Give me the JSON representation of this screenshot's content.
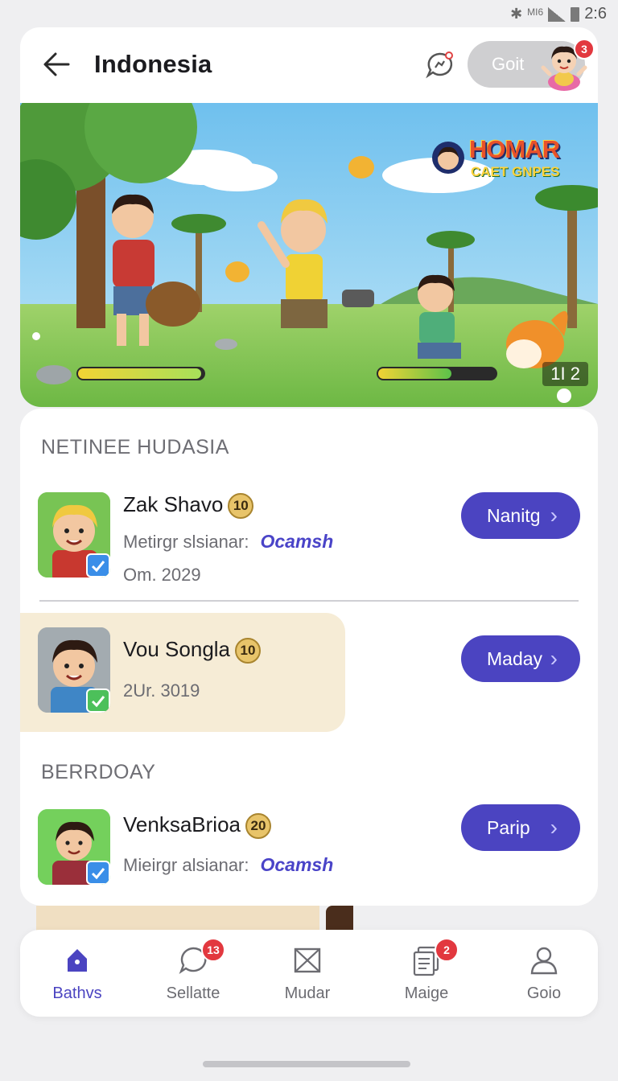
{
  "status_bar": {
    "network": "MI6",
    "time": "2:6"
  },
  "header": {
    "title": "Indonesia",
    "pill_label": "Goit",
    "pill_badge": "3"
  },
  "banner": {
    "logo_line1": "HOMAR",
    "logo_line2": "CAET GNPES",
    "score": "1I 2",
    "left_health": 0.98,
    "right_health": 0.62
  },
  "sections": [
    {
      "title": "NETINEE HUDASIA",
      "rows": [
        {
          "name": "Zak Shavo",
          "emoji_label": "10",
          "sub_label": "Metirgr slsianar:",
          "brand": "Ocamsh",
          "date": "Om. 2029",
          "button": "Nanitg"
        },
        {
          "name": "Vou Songla",
          "emoji_label": "10",
          "date": "2Ur. 3019",
          "button": "Maday"
        }
      ]
    },
    {
      "title": "BERRDOAY",
      "rows": [
        {
          "name": "VenksaBrioa",
          "emoji_label": "20",
          "sub_label": "Mieirgr alsianar:",
          "brand": "Ocamsh",
          "button": "Parip"
        }
      ]
    }
  ],
  "nav": [
    {
      "label": "Bathvs",
      "icon": "home-icon",
      "badge": ""
    },
    {
      "label": "Sellatte",
      "icon": "chat-icon",
      "badge": "13"
    },
    {
      "label": "Mudar",
      "icon": "mail-icon",
      "badge": ""
    },
    {
      "label": "Maige",
      "icon": "document-icon",
      "badge": "2"
    },
    {
      "label": "Goio",
      "icon": "profile-icon",
      "badge": ""
    }
  ],
  "colors": {
    "accent": "#4b44c1",
    "badge": "#e2383f",
    "highlight": "#f6ecd6"
  }
}
